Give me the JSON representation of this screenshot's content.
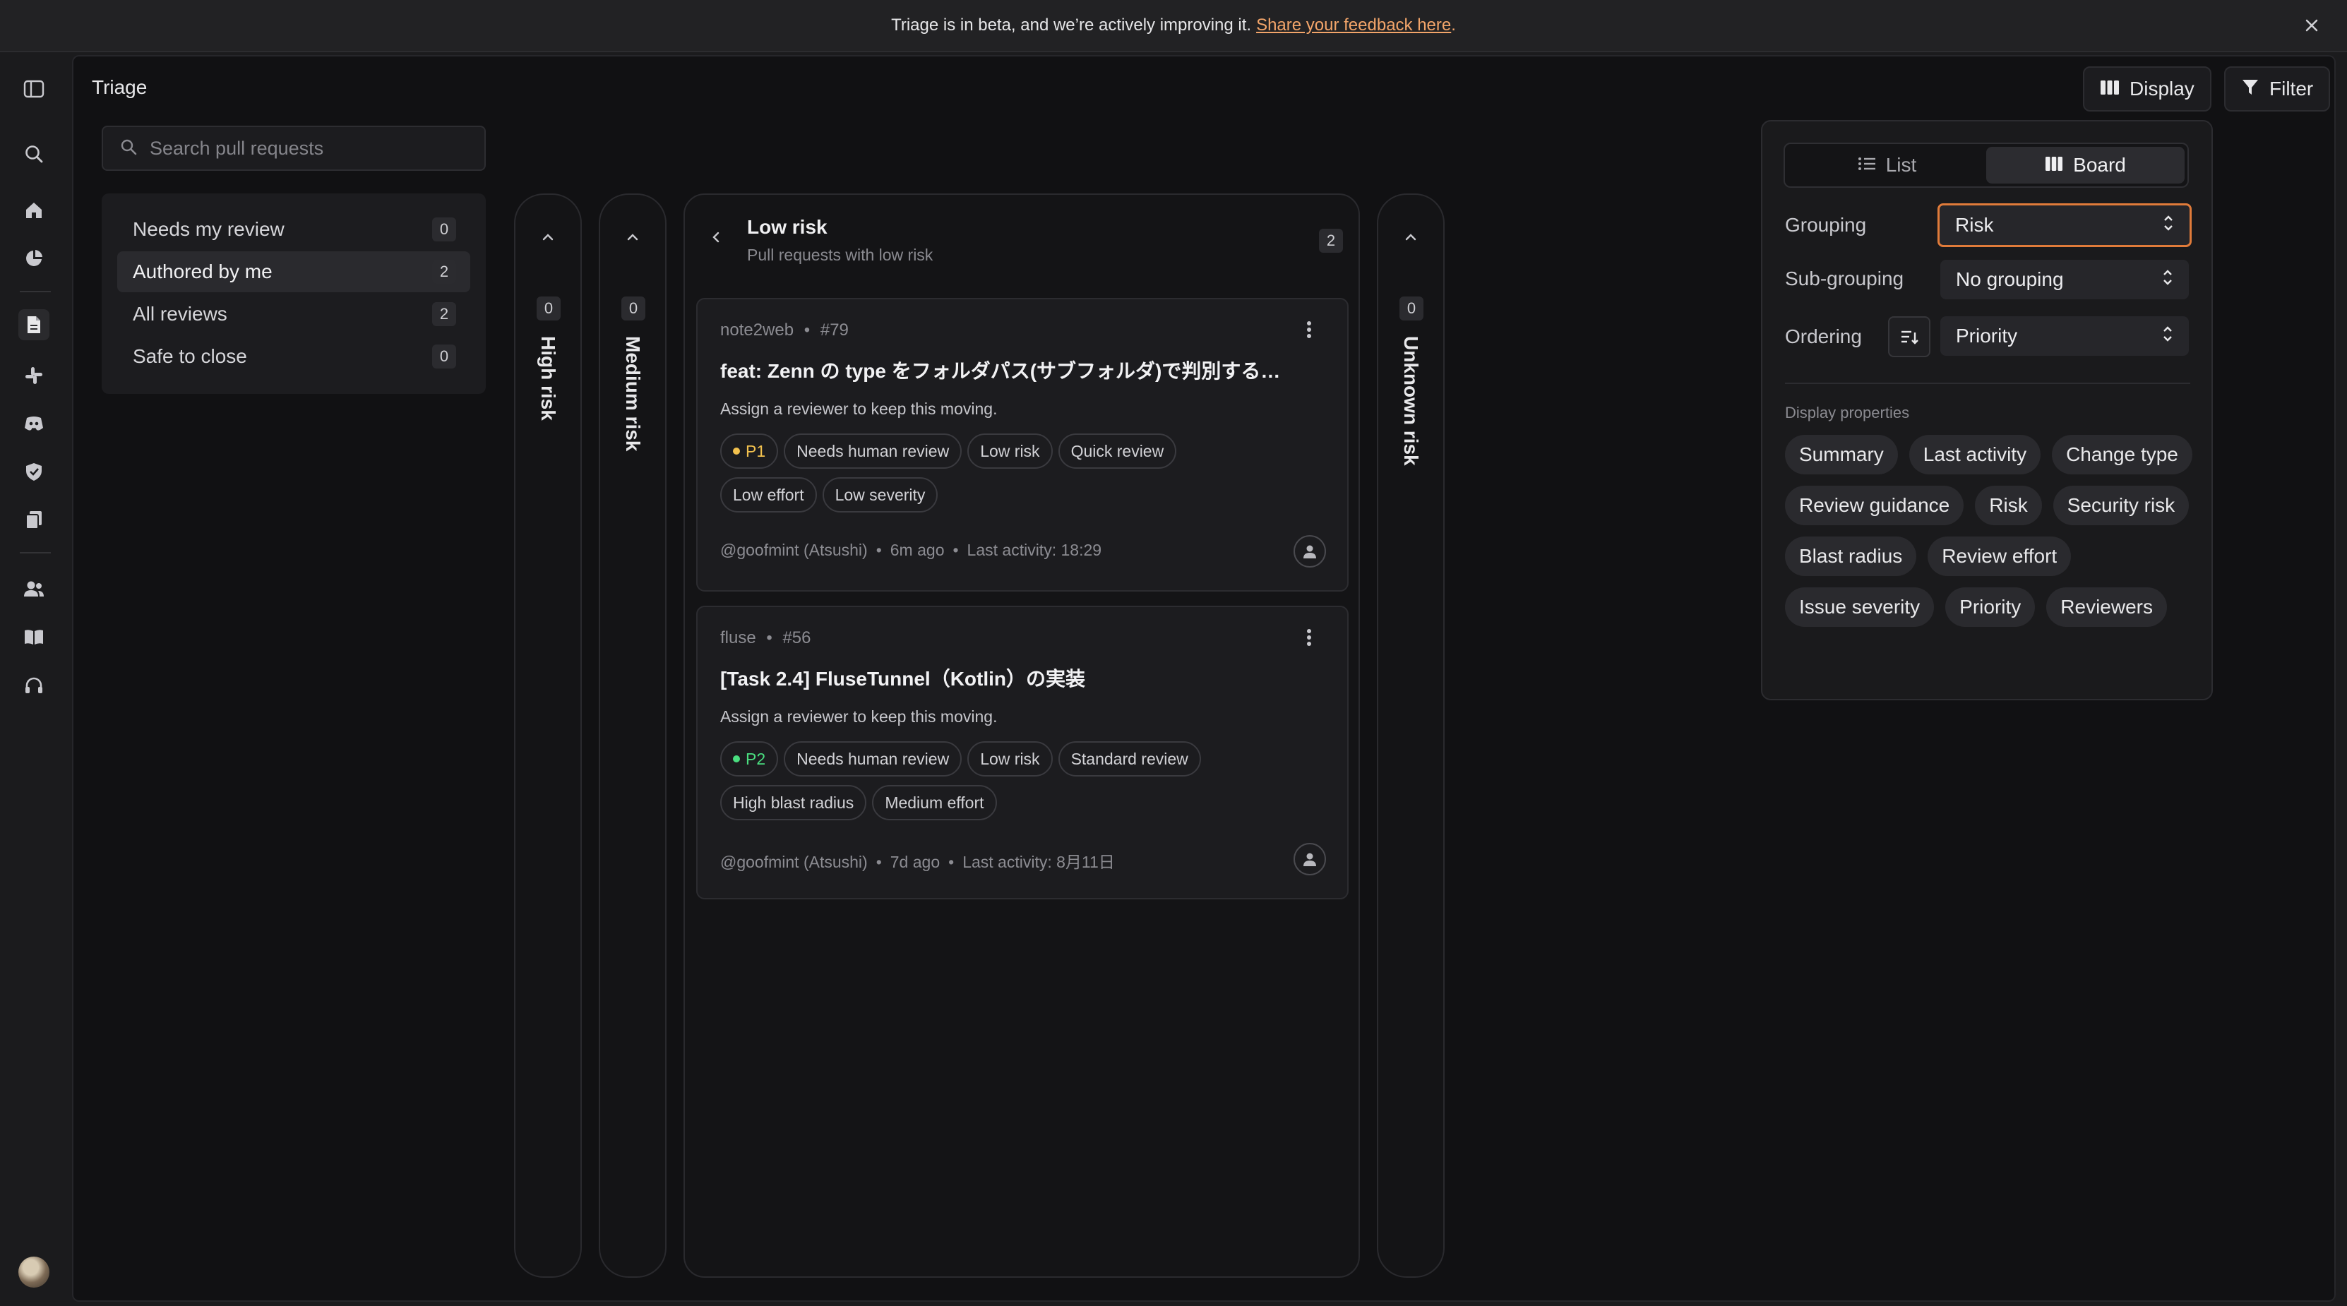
{
  "banner": {
    "text": "Triage is in beta, and we’re actively improving it.",
    "link": "Share your feedback here",
    "link_suffix": "."
  },
  "nav_icons": [
    "sidebar-toggle-icon",
    "search-icon",
    "home-icon",
    "pie-chart-icon",
    "document-icon",
    "slack-icon",
    "discord-icon",
    "shield-icon",
    "copy-icon",
    "users-icon",
    "book-icon",
    "headset-icon"
  ],
  "header": {
    "title": "Triage",
    "display_label": "Display",
    "filter_label": "Filter"
  },
  "search": {
    "placeholder": "Search pull requests"
  },
  "filters": [
    {
      "label": "Needs my review",
      "count": "0"
    },
    {
      "label": "Authored by me",
      "count": "2"
    },
    {
      "label": "All reviews",
      "count": "2"
    },
    {
      "label": "Safe to close",
      "count": "0"
    }
  ],
  "columns": {
    "high": {
      "label": "High risk",
      "count": "0"
    },
    "medium": {
      "label": "Medium risk",
      "count": "0"
    },
    "low": {
      "label": "Low risk",
      "subtitle": "Pull requests with low risk",
      "count": "2"
    },
    "unknown": {
      "label": "Unknown risk",
      "count": "0"
    }
  },
  "cards": [
    {
      "repo": "note2web",
      "number": "#79",
      "title": "feat: Zenn の type をフォルダパス(サブフォルダ)で判別する…",
      "hint": "Assign a reviewer to keep this moving.",
      "priority": "P1",
      "priority_color": "#f2c14e",
      "tags": [
        "Needs human review",
        "Low risk",
        "Quick review",
        "Low effort",
        "Low severity"
      ],
      "author": "@goofmint (Atsushi)",
      "age": "6m ago",
      "last_activity": "Last activity: 18:29"
    },
    {
      "repo": "fluse",
      "number": "#56",
      "title": "[Task 2.4] FluseTunnel（Kotlin）の実装",
      "hint": "Assign a reviewer to keep this moving.",
      "priority": "P2",
      "priority_color": "#4ade80",
      "tags": [
        "Needs human review",
        "Low risk",
        "Standard review",
        "High blast radius",
        "Medium effort"
      ],
      "author": "@goofmint (Atsushi)",
      "age": "7d ago",
      "last_activity": "Last activity: 8月11日"
    }
  ],
  "display_panel": {
    "view_list": "List",
    "view_board": "Board",
    "grouping_label": "Grouping",
    "grouping_value": "Risk",
    "subgrouping_label": "Sub-grouping",
    "subgrouping_value": "No grouping",
    "ordering_label": "Ordering",
    "ordering_value": "Priority",
    "properties_label": "Display properties",
    "properties": [
      "Summary",
      "Last activity",
      "Change type",
      "Review guidance",
      "Risk",
      "Security risk",
      "Blast radius",
      "Review effort",
      "Issue severity",
      "Priority",
      "Reviewers"
    ]
  },
  "colors": {
    "accent_link": "#f3a56a",
    "focus_ring": "#e07b3a"
  }
}
